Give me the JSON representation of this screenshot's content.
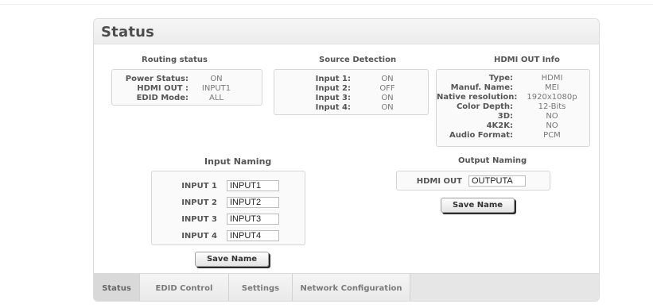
{
  "page_title": "Status",
  "routing": {
    "title": "Routing status",
    "rows": [
      {
        "key": "Power Status:",
        "value": "ON"
      },
      {
        "key": "HDMI OUT :",
        "value": "INPUT1"
      },
      {
        "key": "EDID Mode:",
        "value": "ALL"
      }
    ]
  },
  "source": {
    "title": "Source Detection",
    "rows": [
      {
        "key": "Input 1:",
        "value": "ON"
      },
      {
        "key": "Input 2:",
        "value": "OFF"
      },
      {
        "key": "Input 3:",
        "value": "ON"
      },
      {
        "key": "Input 4:",
        "value": "ON"
      }
    ]
  },
  "hdmi_info": {
    "title": "HDMI OUT Info",
    "rows": [
      {
        "key": "Type:",
        "value": "HDMI"
      },
      {
        "key": "Manuf. Name:",
        "value": "MEI"
      },
      {
        "key": "Native resolution:",
        "value": "1920x1080p"
      },
      {
        "key": "Color Depth:",
        "value": "12-Bits"
      },
      {
        "key": "3D:",
        "value": "NO"
      },
      {
        "key": "4K2K:",
        "value": "NO"
      },
      {
        "key": "Audio Format:",
        "value": "PCM"
      }
    ]
  },
  "input_naming": {
    "title": "Input Naming",
    "rows": [
      {
        "label": "INPUT 1",
        "value": "INPUT1"
      },
      {
        "label": "INPUT 2",
        "value": "INPUT2"
      },
      {
        "label": "INPUT 3",
        "value": "INPUT3"
      },
      {
        "label": "INPUT 4",
        "value": "INPUT4"
      }
    ],
    "save_label": "Save Name"
  },
  "output_naming": {
    "title": "Output Naming",
    "label": "HDMI OUT",
    "value": "OUTPUTA",
    "save_label": "Save Name"
  },
  "tabs": [
    {
      "label": "Status",
      "active": true
    },
    {
      "label": "EDID Control",
      "active": false
    },
    {
      "label": "Settings",
      "active": false
    },
    {
      "label": "Network Configuration",
      "active": false
    }
  ]
}
